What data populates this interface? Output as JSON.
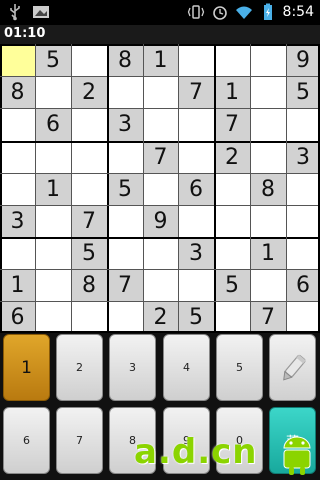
{
  "status_bar": {
    "time": "8:54",
    "left_icons": [
      "usb-icon",
      "gallery-icon"
    ],
    "right_icons": [
      "vibrate-icon",
      "alarm-icon",
      "wifi-icon",
      "battery-icon"
    ]
  },
  "timer": "01:10",
  "board": {
    "selected_cell": [
      0,
      0
    ],
    "selected_color": "#ffff9a",
    "given_color": "#d2d2d2",
    "grid": [
      [
        "",
        "5",
        "",
        "8",
        "1",
        "",
        "",
        "",
        "9"
      ],
      [
        "8",
        "",
        "2",
        "",
        "",
        "7",
        "1",
        "",
        "5"
      ],
      [
        "",
        "6",
        "",
        "3",
        "",
        "",
        "7",
        "",
        ""
      ],
      [
        "",
        "",
        "",
        "",
        "7",
        "",
        "2",
        "",
        "3"
      ],
      [
        "",
        "1",
        "",
        "5",
        "",
        "6",
        "",
        "8",
        ""
      ],
      [
        "3",
        "",
        "7",
        "",
        "9",
        "",
        "",
        "",
        ""
      ],
      [
        "",
        "",
        "5",
        "",
        "",
        "3",
        "",
        "1",
        ""
      ],
      [
        "1",
        "",
        "8",
        "7",
        "",
        "",
        "5",
        "",
        "6"
      ],
      [
        "6",
        "",
        "",
        "",
        "2",
        "5",
        "",
        "7",
        ""
      ]
    ],
    "shaded": [
      [
        0,
        1
      ],
      [
        0,
        3
      ],
      [
        0,
        4
      ],
      [
        0,
        8
      ],
      [
        1,
        0
      ],
      [
        1,
        2
      ],
      [
        1,
        5
      ],
      [
        1,
        6
      ],
      [
        1,
        8
      ],
      [
        2,
        1
      ],
      [
        2,
        3
      ],
      [
        2,
        6
      ],
      [
        3,
        4
      ],
      [
        3,
        6
      ],
      [
        3,
        8
      ],
      [
        4,
        1
      ],
      [
        4,
        3
      ],
      [
        4,
        5
      ],
      [
        4,
        7
      ],
      [
        5,
        0
      ],
      [
        5,
        2
      ],
      [
        5,
        4
      ],
      [
        6,
        2
      ],
      [
        6,
        5
      ],
      [
        6,
        7
      ],
      [
        7,
        0
      ],
      [
        7,
        2
      ],
      [
        7,
        3
      ],
      [
        7,
        6
      ],
      [
        7,
        8
      ],
      [
        8,
        0
      ],
      [
        8,
        4
      ],
      [
        8,
        5
      ],
      [
        8,
        7
      ]
    ]
  },
  "keypad": {
    "row1": [
      "1",
      "2",
      "3",
      "4",
      "5"
    ],
    "row2": [
      "6",
      "7",
      "8",
      "9",
      "0"
    ],
    "active_key": "1",
    "pencil_icon": "pencil-icon",
    "extra_key_label": "菜",
    "accent_color": "#d39a1e"
  },
  "watermark": {
    "text": "a.d.cn",
    "icon": "android-icon"
  }
}
